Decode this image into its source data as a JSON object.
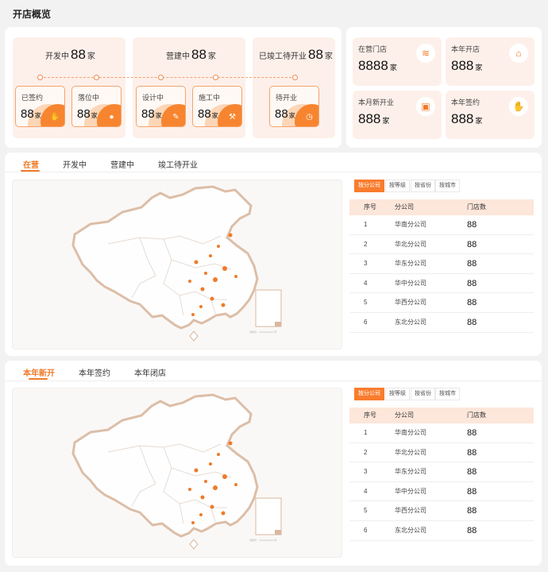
{
  "title": "开店概览",
  "overview": {
    "stages": [
      {
        "label": "开发中",
        "value": "88",
        "unit": "家"
      },
      {
        "label": "营建中",
        "value": "88",
        "unit": "家"
      },
      {
        "label": "已竣工待开业",
        "value": "88",
        "unit": "家"
      }
    ],
    "substages": [
      {
        "label": "已签约",
        "value": "88",
        "unit": "家",
        "icon": "handshake-icon"
      },
      {
        "label": "落位中",
        "value": "88",
        "unit": "家",
        "icon": "location-pin-icon"
      },
      {
        "label": "设计中",
        "value": "88",
        "unit": "家",
        "icon": "design-tools-icon"
      },
      {
        "label": "施工中",
        "value": "88",
        "unit": "家",
        "icon": "wrench-icon"
      },
      {
        "label": "待开业",
        "value": "88",
        "unit": "家",
        "icon": "clock-icon"
      }
    ]
  },
  "stats": [
    {
      "label": "在营门店",
      "value": "8888",
      "unit": "家",
      "icon": "layers-icon"
    },
    {
      "label": "本年开店",
      "value": "888",
      "unit": "家",
      "icon": "storefront-icon"
    },
    {
      "label": "本月新开业",
      "value": "888",
      "unit": "家",
      "icon": "open-sign-icon"
    },
    {
      "label": "本年签约",
      "value": "888",
      "unit": "家",
      "icon": "handshake-icon"
    }
  ],
  "section1": {
    "tabs": [
      "在营",
      "开发中",
      "营建中",
      "竣工待开业"
    ],
    "active_tab": 0
  },
  "section2": {
    "tabs": [
      "本年新开",
      "本年签约",
      "本年闭店"
    ],
    "active_tab": 0
  },
  "filters": [
    "按分公司",
    "按等级",
    "按省份",
    "按城市"
  ],
  "table": {
    "headers": [
      "序号",
      "分公司",
      "门店数"
    ],
    "rows": [
      [
        "1",
        "华南分公司",
        "88"
      ],
      [
        "2",
        "华北分公司",
        "88"
      ],
      [
        "3",
        "华东分公司",
        "88"
      ],
      [
        "4",
        "华中分公司",
        "88"
      ],
      [
        "5",
        "华西分公司",
        "88"
      ],
      [
        "6",
        "东北分公司",
        "88"
      ]
    ]
  },
  "map": {
    "outline_color": "#d9b8a0",
    "dot_color": "#f07a2a",
    "legend_text": "审图号：GS(2019)1822号"
  }
}
